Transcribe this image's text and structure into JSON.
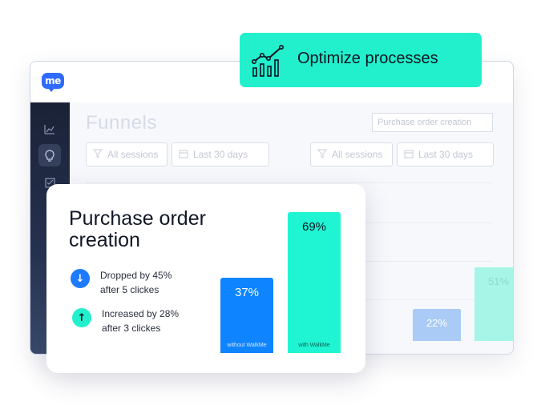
{
  "banner": {
    "label": "Optimize processes",
    "icon": "growth-chart-icon",
    "color": "#22f0cd"
  },
  "app": {
    "logo_text": "me",
    "sidebar": {
      "icons": [
        "line-chart-icon",
        "lightbulb-icon",
        "checklist-icon"
      ]
    },
    "page_title": "Funnels",
    "funnel_select": "Purchase order creation",
    "filters_left": {
      "sessions": "All sessions",
      "date": "Last 30 days"
    },
    "filters_right": {
      "sessions": "All sessions",
      "date": "Last 30 days"
    },
    "bg_bars": [
      {
        "value": 0.22,
        "label": "22%",
        "color": "#a9cbf5"
      },
      {
        "value": 0.51,
        "label": "51%",
        "color": "#a6f5e7"
      }
    ]
  },
  "card": {
    "title": "Purchase order creation",
    "stats": [
      {
        "direction": "down",
        "text_line1": "Dropped by 45%",
        "text_line2": "after 5 clickes",
        "color": "#1e7bff"
      },
      {
        "direction": "up",
        "text_line1": "Increased by 28%",
        "text_line2": "after 3 clickes",
        "color": "#22f0cd"
      }
    ],
    "bars": [
      {
        "value": 0.37,
        "label": "37%",
        "caption": "without WalkMe",
        "color": "#0e84ff"
      },
      {
        "value": 0.69,
        "label": "69%",
        "caption": "with WalkMe",
        "color": "#1ff5d2"
      }
    ]
  }
}
